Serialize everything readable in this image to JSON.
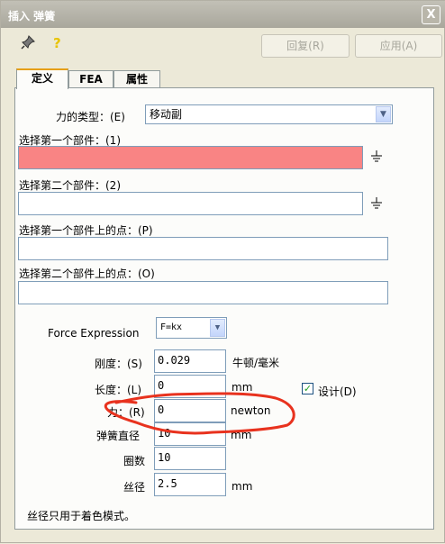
{
  "window": {
    "title": "插入 弹簧",
    "close_glyph": "X"
  },
  "toolbar": {
    "pin_icon": "pin-icon",
    "help_icon": "help-icon",
    "reply_label": "回复(R)",
    "apply_label": "应用(A)"
  },
  "tabs": [
    {
      "label": "定义"
    },
    {
      "label": "FEA"
    },
    {
      "label": "属性"
    }
  ],
  "force_type": {
    "label": "力的类型：(E)",
    "value": "移动副"
  },
  "part1": {
    "label": "选择第一个部件：(1)",
    "value": ""
  },
  "part2": {
    "label": "选择第二个部件：(2)",
    "value": ""
  },
  "point1": {
    "label": "选择第一个部件上的点：(P)",
    "value": ""
  },
  "point2": {
    "label": "选择第二个部件上的点：(O)",
    "value": ""
  },
  "force_expression": {
    "label": "Force Expression",
    "value": "F=kx"
  },
  "stiffness": {
    "label": "刚度：(S)",
    "value": "0.029",
    "unit": "牛顿/毫米"
  },
  "length": {
    "label": "长度：(L)",
    "value": "0",
    "unit": "mm"
  },
  "design": {
    "label": "设计(D)",
    "checked": true
  },
  "force": {
    "label": "力：(R)",
    "value": "0",
    "unit": "newton"
  },
  "diameter": {
    "label": "弹簧直径",
    "value": "10",
    "unit": "mm"
  },
  "coils": {
    "label": "圈数",
    "value": "10"
  },
  "wire": {
    "label": "丝径",
    "value": "2.5",
    "unit": "mm"
  },
  "note": "丝径只用于着色模式。",
  "colors": {
    "highlight_field": "#f98484",
    "annotation": "#e8321e",
    "titlebar": "#b3b1a6"
  }
}
